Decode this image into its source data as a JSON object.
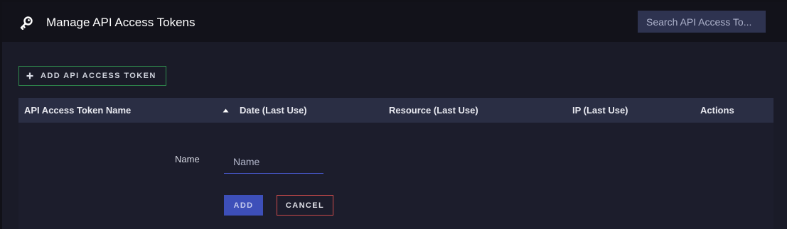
{
  "header": {
    "title": "Manage API Access Tokens",
    "icon": "key-icon",
    "search_placeholder": "Search API Access To..."
  },
  "toolbar": {
    "add_token_label": "ADD API ACCESS TOKEN",
    "add_icon": "plus-icon"
  },
  "table": {
    "columns": [
      {
        "label": "API Access Token Name",
        "sortable": true,
        "sort": "ascending"
      },
      {
        "label": "Date (Last Use)"
      },
      {
        "label": "Resource (Last Use)"
      },
      {
        "label": "IP (Last Use)"
      },
      {
        "label": "Actions"
      }
    ]
  },
  "form": {
    "name_label": "Name",
    "name_value": "",
    "name_placeholder": "Name",
    "add_label": "ADD",
    "cancel_label": "CANCEL"
  },
  "colors": {
    "background": "#1a1b28",
    "header": "#12121a",
    "table_header": "#2a2e44",
    "accent": "#3d4fb9",
    "success_border": "#2f8a4d",
    "danger_border": "#c94a4a"
  }
}
